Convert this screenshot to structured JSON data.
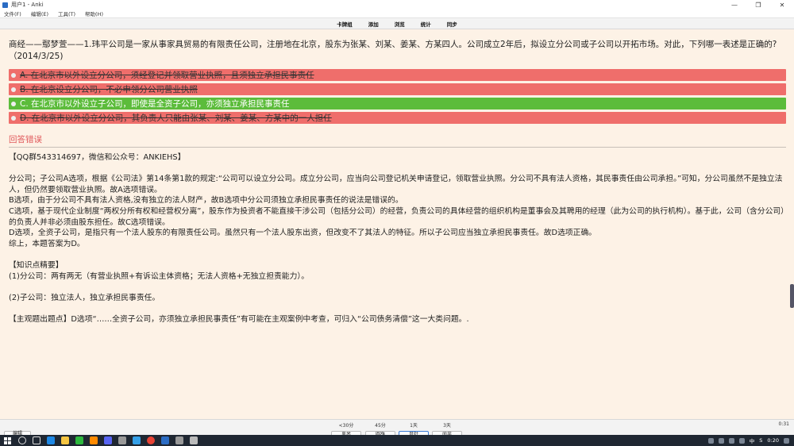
{
  "window": {
    "title": "用户1 - Anki",
    "minimize": "—",
    "maximize": "❐",
    "close": "✕"
  },
  "menu": {
    "items": [
      "文件(F)",
      "编辑(E)",
      "工具(T)",
      "帮助(H)"
    ]
  },
  "toolbar": {
    "items": [
      "卡牌组",
      "添加",
      "浏览",
      "统计",
      "同步"
    ]
  },
  "question": {
    "text": "商经——鄢梦萱——1.玮平公司是一家从事家具贸易的有限责任公司，注册地在北京，股东为张某、刘某、姜某、方某四人。公司成立2年后，拟设立分公司或子公司以开拓市场。对此，下列哪一表述是正确的?（2014/3/25)"
  },
  "options": [
    {
      "text": "A. 在北京市以外设立分公司，须经登记并领取营业执照，且须独立承担民事责任",
      "status": "wrong"
    },
    {
      "text": "B. 在北京设立分公司，不必申领分公司营业执照",
      "status": "wrong"
    },
    {
      "text": "C. 在北京市以外设立子公司，即使是全资子公司，亦须独立承担民事责任",
      "status": "right"
    },
    {
      "text": "D. 在北京市以外设立分公司，其负责人只能由张某、刘某、姜某、方某中的一人担任",
      "status": "wrong"
    }
  ],
  "result": {
    "text": "回答错误"
  },
  "explanation": [
    "【QQ群543314697，微信和公众号：ANKIEHS】",
    "",
    "分公司；子公司A选项，根据《公司法》第14条第1款的规定:“公司可以设立分公司。成立分公司，应当向公司登记机关申请登记，领取营业执照。分公司不具有法人资格，其民事责任由公司承担。”可知，分公司虽然不是独立法人，但仍然要领取营业执照。故A选项错误。",
    "B选项，由于分公司不具有法人资格,没有独立的法人财产，故B选项中分公司须独立承担民事责任的说法是错误的。",
    "C选项，基于现代企业制度“两权分所有权和经营权分离”，股东作为投资者不能直接干涉公司（包括分公司）的经营，负责公司的具体经营的组织机构是董事会及其聘用的经理（此为公司的执行机构）。基于此，公司（含分公司）的负责人并非必须由股东担任。故C选项错误。",
    "D选项，全资子公司，是指只有一个法人股东的有限责任公司。虽然只有一个法人股东出资，但改变不了其法人的特征。所以子公司应当独立承担民事责任。故D选项正确。",
    "综上，本题答案为D。",
    "",
    "【知识点精要】",
    "(1)分公司：两有两无（有营业执照+有诉讼主体资格；无法人资格+无独立担责能力）。",
    "",
    "(2)子公司：独立法人，独立承担民事责任。",
    "",
    "【主观题出题点】D选项“……全资子公司，亦须独立承担民事责任”有可能在主观案例中考查，可归入“公司债务清偿”这一大类问题。."
  ],
  "bottom": {
    "edit_label": "编辑",
    "intervals": [
      "<30分",
      "45分",
      "1天",
      "3天"
    ],
    "ease_labels": [
      "重来",
      "困难",
      "良好",
      "简单"
    ],
    "timer": "0:31"
  },
  "taskbar": {
    "tray_lang": "中",
    "tray_ime": "S",
    "clock": "0:20"
  },
  "colors": {
    "wrong": "#ef6e6b",
    "right": "#5cbc3b",
    "verdict": "#e0585a",
    "background": "#fdf2e6"
  }
}
